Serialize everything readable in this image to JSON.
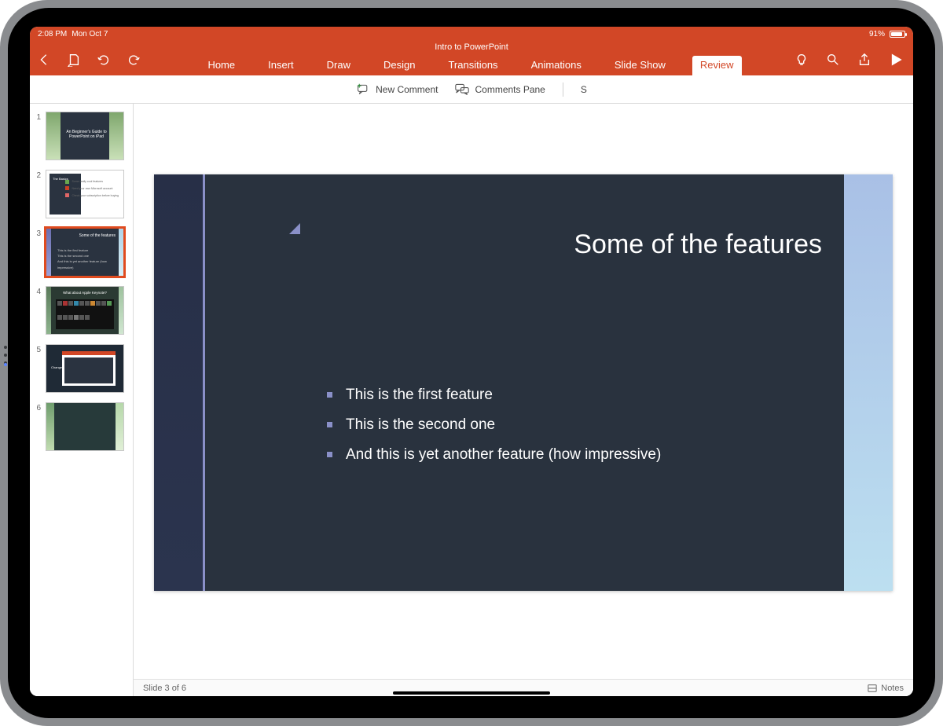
{
  "status": {
    "time": "2:08 PM",
    "date": "Mon Oct 7",
    "battery": "91%"
  },
  "header": {
    "doc_title": "Intro to PowerPoint",
    "tabs": {
      "home": "Home",
      "insert": "Insert",
      "draw": "Draw",
      "design": "Design",
      "transitions": "Transitions",
      "animations": "Animations",
      "slideshow": "Slide Show",
      "review": "Review"
    },
    "active_tab": "review"
  },
  "ribbon": {
    "new_comment": "New Comment",
    "comments_pane": "Comments Pane",
    "extra": "S"
  },
  "thumbs": {
    "t1": "An Beginner's Guide to PowerPoint on iPad",
    "t2_title": "The Basics",
    "t2_r1": "Some really cool features",
    "t2_r2": "Need your own Microsoft account",
    "t2_r3": "Check your subscription before buying",
    "t3_title": "Some of the features",
    "t3_b1": "This is the first feature",
    "t3_b2": "This is the second one",
    "t3_b3": "And this is yet another feature (how impressive)",
    "t4_title": "What about Apple Keynote?",
    "t5_label": "Change"
  },
  "slide": {
    "title": "Some of the features",
    "bullets": {
      "b1": "This is the first feature",
      "b2": "This is the second one",
      "b3": "And this is yet another feature (how impressive)"
    }
  },
  "footer": {
    "position": "Slide 3 of 6",
    "notes": "Notes"
  }
}
